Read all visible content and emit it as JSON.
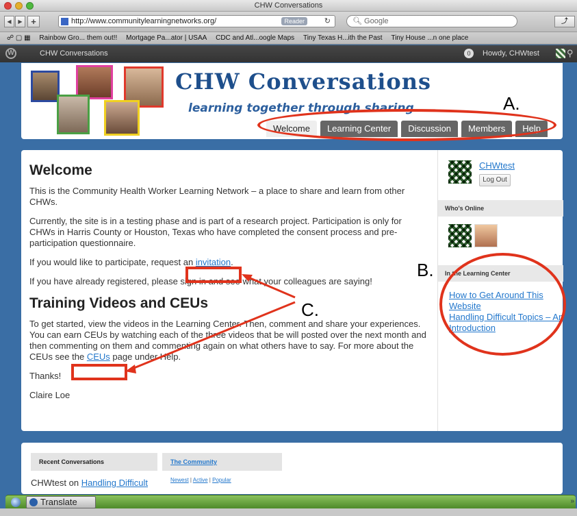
{
  "window": {
    "title": "CHW Conversations"
  },
  "browser": {
    "url": "http://www.communitylearningnetworks.org/",
    "reader_label": "Reader",
    "search_placeholder": "Google",
    "bookmarks": [
      "Rainbow Gro... them out!!",
      "Mortgage Pa...ator | USAA",
      "CDC and Atl...oogle Maps",
      "Tiny Texas H...ith the Past",
      "Tiny House ...n one place"
    ]
  },
  "adminbar": {
    "site": "CHW Conversations",
    "notif_count": "0",
    "howdy": "Howdy, CHWtest"
  },
  "header": {
    "logo": "CHW Conversations",
    "tagline": "learning together through sharing",
    "nav": [
      "Welcome",
      "Learning Center",
      "Discussion",
      "Members",
      "Help"
    ],
    "active_tab": "Welcome"
  },
  "annotations": {
    "a": "A.",
    "b": "B.",
    "c": "C."
  },
  "content": {
    "title": "Welcome",
    "p1": "This is the Community Health Worker Learning Network – a place to share and learn from other CHWs.",
    "p2": "Currently, the site is in a testing phase and is part of a research project. Participation is only for CHWs in Harris County or Houston, Texas who have completed the consent process and pre-participation questionnaire.",
    "p3_pre": "If you would like to participate, request an ",
    "p3_link": "invitation",
    "p3_post": ".",
    "p4": "If you have already registered, please sign in and see what your colleagues are saying!",
    "h2": "Training Videos and CEUs",
    "p5_pre": "To get started, view the videos in the Learning Center. Then, comment and share your experiences. You can earn CEUs by watching each of the three videos that be will posted over the next month and then commenting on them and commenting again on what others have to say. For more about the CEUs see the ",
    "p5_link": "CEUs",
    "p5_post": " page under Help.",
    "thanks": "Thanks!",
    "signature": "Claire Loe"
  },
  "sidebar": {
    "username": "CHWtest",
    "logout": "Log Out",
    "whos_online": "Who's Online",
    "learning_center_head": "In the Learning Center",
    "links": [
      "How to Get Around This Website",
      "Handling Difficult Topics – An Introduction"
    ]
  },
  "footer": {
    "recent_head": "Recent Conversations",
    "recent_user": "CHWtest",
    "recent_on": " on ",
    "recent_link": "Handling Difficult",
    "community_head": "The Community",
    "community_links": [
      "Newest",
      "Active",
      "Popular"
    ]
  },
  "translate": {
    "label": "Translate"
  }
}
